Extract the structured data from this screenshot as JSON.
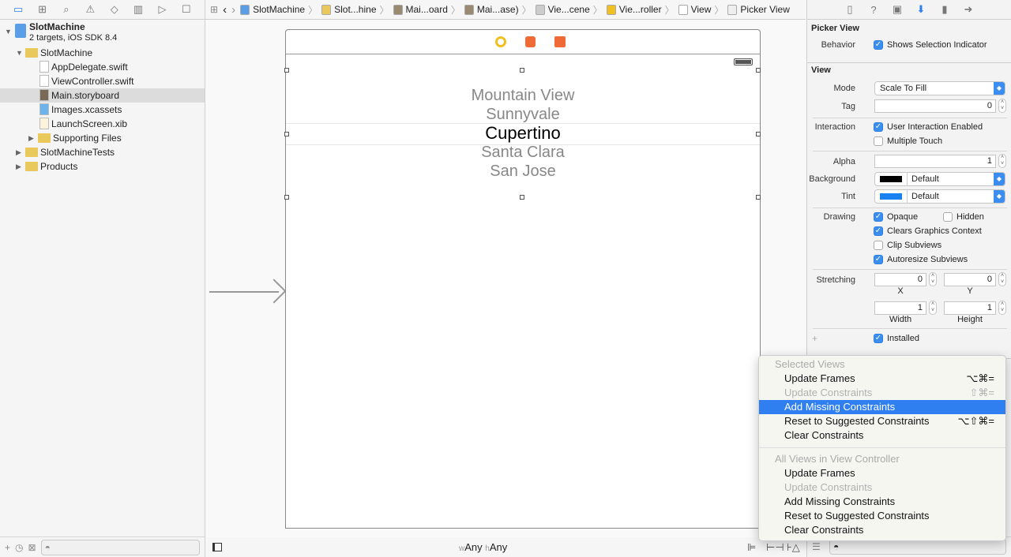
{
  "navigator": {
    "tab_icons": [
      "folder-icon",
      "hierarchy-icon",
      "search-icon",
      "warning-icon",
      "test-icon",
      "debug-icon",
      "breakpoint-icon",
      "report-icon"
    ],
    "project": {
      "name": "SlotMachine",
      "subtitle": "2 targets, iOS SDK 8.4"
    },
    "items": [
      {
        "label": "SlotMachine",
        "type": "folder",
        "expanded": true
      },
      {
        "label": "AppDelegate.swift",
        "type": "swift"
      },
      {
        "label": "ViewController.swift",
        "type": "swift"
      },
      {
        "label": "Main.storyboard",
        "type": "storyboard",
        "selected": true
      },
      {
        "label": "Images.xcassets",
        "type": "assets"
      },
      {
        "label": "LaunchScreen.xib",
        "type": "xib"
      },
      {
        "label": "Supporting Files",
        "type": "folder",
        "expanded": false
      },
      {
        "label": "SlotMachineTests",
        "type": "folder",
        "expanded": false
      },
      {
        "label": "Products",
        "type": "folder",
        "expanded": false
      }
    ]
  },
  "jumpbar": {
    "crumbs": [
      "SlotMachine",
      "Slot...hine",
      "Mai...oard",
      "Mai...ase)",
      "Vie...cene",
      "Vie...roller",
      "View",
      "Picker View"
    ]
  },
  "canvas": {
    "picker_rows": [
      "Mountain View",
      "Sunnyvale",
      "Cupertino",
      "Santa Clara",
      "San Jose"
    ],
    "selected_row": "Cupertino",
    "size_class": {
      "w_prefix": "w",
      "w": "Any",
      "h_prefix": "h",
      "h": "Any"
    }
  },
  "inspector": {
    "picker_section": "Picker View",
    "behavior_label": "Behavior",
    "shows_selection": "Shows Selection Indicator",
    "view_section": "View",
    "mode_label": "Mode",
    "mode": "Scale To Fill",
    "tag_label": "Tag",
    "tag": "0",
    "interaction_label": "Interaction",
    "user_interaction": "User Interaction Enabled",
    "multiple_touch": "Multiple Touch",
    "alpha_label": "Alpha",
    "alpha": "1",
    "background_label": "Background",
    "background": "Default",
    "background_color": "#000000",
    "tint_label": "Tint",
    "tint": "Default",
    "tint_color": "#1a82f0",
    "drawing_label": "Drawing",
    "opaque": "Opaque",
    "hidden": "Hidden",
    "clears": "Clears Graphics Context",
    "clip": "Clip Subviews",
    "autoresize": "Autoresize Subviews",
    "stretching_label": "Stretching",
    "sx": "0",
    "sy": "0",
    "sw": "1",
    "sh": "1",
    "x_label": "X",
    "y_label": "Y",
    "width_label": "Width",
    "height_label": "Height",
    "installed": "Installed"
  },
  "menu": {
    "header1": "Selected Views",
    "sel_items": [
      {
        "label": "Update Frames",
        "shortcut": "⌥⌘=",
        "enabled": true
      },
      {
        "label": "Update Constraints",
        "shortcut": "⇧⌘=",
        "enabled": false
      },
      {
        "label": "Add Missing Constraints",
        "shortcut": "",
        "enabled": true,
        "highlighted": true
      },
      {
        "label": "Reset to Suggested Constraints",
        "shortcut": "⌥⇧⌘=",
        "enabled": true
      },
      {
        "label": "Clear Constraints",
        "shortcut": "",
        "enabled": true
      }
    ],
    "header2": "All Views in View Controller",
    "all_items": [
      {
        "label": "Update Frames",
        "enabled": true
      },
      {
        "label": "Update Constraints",
        "enabled": false
      },
      {
        "label": "Add Missing Constraints",
        "enabled": true
      },
      {
        "label": "Reset to Suggested Constraints",
        "enabled": true
      },
      {
        "label": "Clear Constraints",
        "enabled": true
      }
    ]
  },
  "colors": {
    "accent": "#2f7ff0"
  }
}
